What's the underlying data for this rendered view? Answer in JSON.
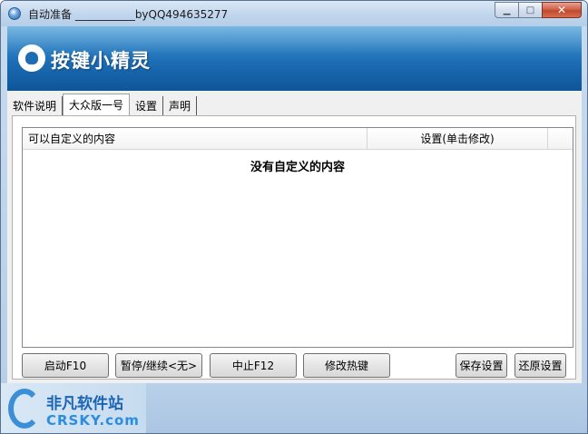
{
  "window": {
    "title": "自动准备 ___________byQQ494635277",
    "minimize_glyph": "▁",
    "maximize_glyph": "□",
    "close_glyph": "✕"
  },
  "banner": {
    "logo_text": "按键小精灵"
  },
  "tabs": [
    {
      "label": "软件说明",
      "active": false
    },
    {
      "label": "大众版一号",
      "active": true
    },
    {
      "label": "设置",
      "active": false
    },
    {
      "label": "声明",
      "active": false
    }
  ],
  "list": {
    "columns": [
      "可以自定义的内容",
      "设置(单击修改)"
    ],
    "empty_message": "没有自定义的内容"
  },
  "buttons": {
    "start": "启动F10",
    "pause": "暂停/继续<无>",
    "stop": "中止F12",
    "hotkey": "修改热键",
    "save": "保存设置",
    "restore": "还原设置"
  },
  "watermark": {
    "title": "非凡软件站",
    "subtitle": "CRSKY.com"
  }
}
